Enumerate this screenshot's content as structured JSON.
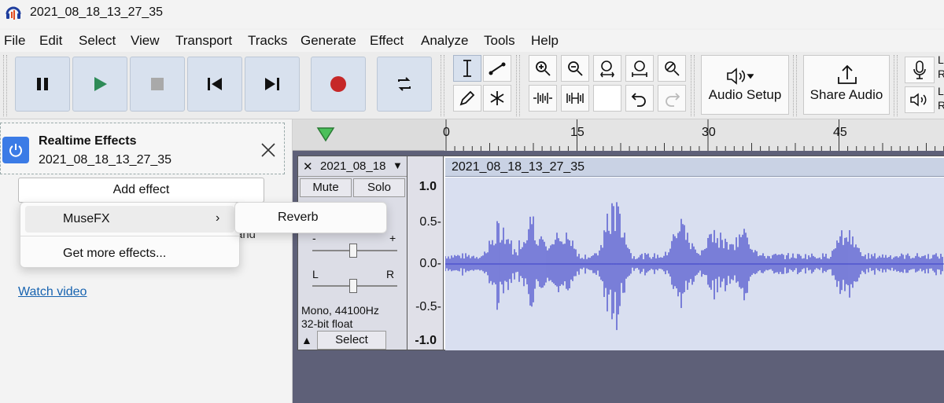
{
  "window": {
    "title": "2021_08_18_13_27_35"
  },
  "menu": [
    "File",
    "Edit",
    "Select",
    "View",
    "Transport",
    "Tracks",
    "Generate",
    "Effect",
    "Analyze",
    "Tools",
    "Help"
  ],
  "toolbar": {
    "audio_setup_label": "Audio Setup",
    "share_audio_label": "Share Audio"
  },
  "realtime_effects": {
    "title": "Realtime Effects",
    "track_name": "2021_08_18_13_27_35",
    "add_effect_label": "Add effect",
    "partial_text": "and",
    "watch_video_label": "Watch video"
  },
  "effects_menu": {
    "items": [
      "MuseFX",
      "Get more effects..."
    ],
    "submenu_items": [
      "Reverb"
    ]
  },
  "timeline": {
    "ticks": [
      "0",
      "15",
      "30",
      "45"
    ]
  },
  "track": {
    "name": "2021_08_18",
    "mute_label": "Mute",
    "solo_label": "Solo",
    "gain_minus": "-",
    "gain_plus": "+",
    "pan_left": "L",
    "pan_right": "R",
    "format_line1": "Mono, 44100Hz",
    "format_line2": "32-bit float",
    "select_label": "Select",
    "clip_title": "2021_08_18_13_27_35",
    "amplitude_labels": [
      "1.0",
      "0.5-",
      "0.0-",
      "-0.5-",
      "-1.0"
    ]
  },
  "colors": {
    "waveform": "#3a3fc9",
    "record": "#c62828",
    "play": "#2e8b57",
    "accent": "#3b7be6"
  }
}
